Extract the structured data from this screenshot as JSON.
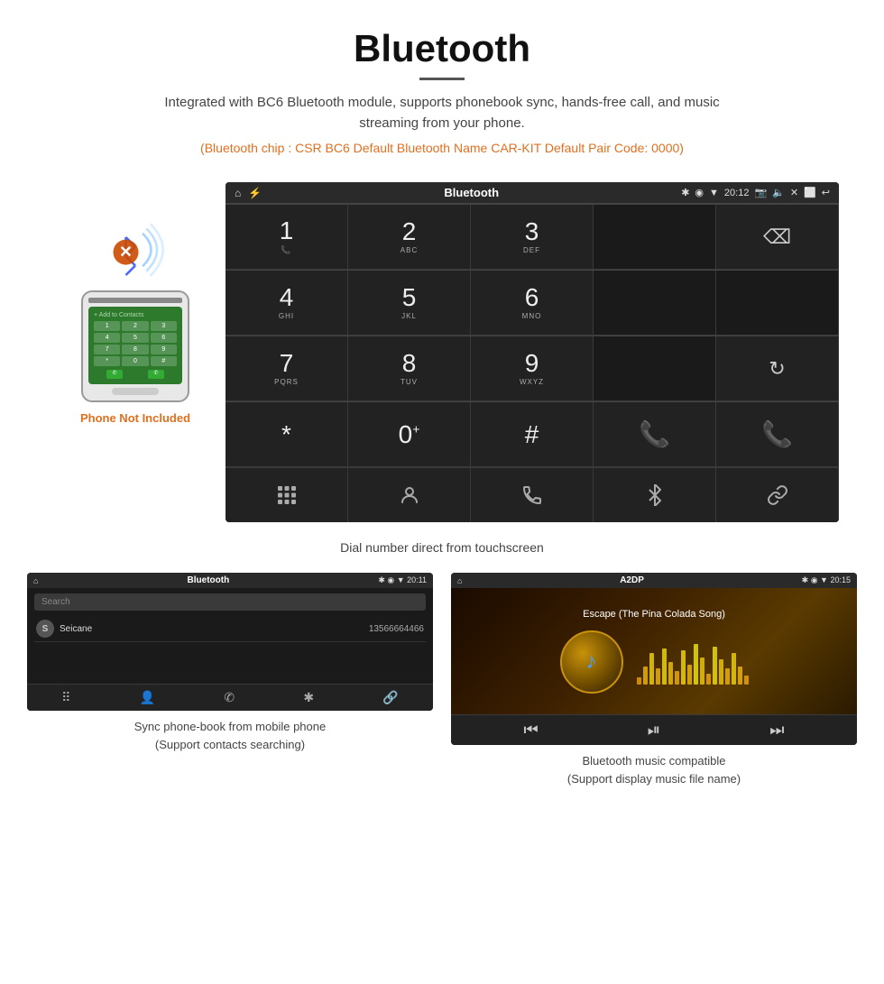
{
  "header": {
    "title": "Bluetooth",
    "subtitle": "Integrated with BC6 Bluetooth module, supports phonebook sync, hands-free call, and music streaming from your phone.",
    "specs": "(Bluetooth chip : CSR BC6    Default Bluetooth Name CAR-KIT    Default Pair Code: 0000)",
    "divider": true
  },
  "phone_note": "Phone Not Included",
  "dialpad_screen": {
    "status_left": "🏠",
    "status_center": "Bluetooth",
    "status_time": "20:12",
    "caption": "Dial number direct from touchscreen",
    "keys": [
      {
        "num": "1",
        "sub": ""
      },
      {
        "num": "2",
        "sub": "ABC"
      },
      {
        "num": "3",
        "sub": "DEF"
      },
      {
        "num": "",
        "sub": ""
      },
      {
        "num": "⌫",
        "sub": ""
      }
    ],
    "keys2": [
      {
        "num": "4",
        "sub": "GHI"
      },
      {
        "num": "5",
        "sub": "JKL"
      },
      {
        "num": "6",
        "sub": "MNO"
      },
      {
        "num": "",
        "sub": ""
      },
      {
        "num": "",
        "sub": ""
      }
    ],
    "keys3": [
      {
        "num": "7",
        "sub": "PQRS"
      },
      {
        "num": "8",
        "sub": "TUV"
      },
      {
        "num": "9",
        "sub": "WXYZ"
      },
      {
        "num": "",
        "sub": ""
      },
      {
        "num": "↻",
        "sub": ""
      }
    ],
    "keys4": [
      {
        "num": "*",
        "sub": ""
      },
      {
        "num": "0",
        "sub": "+"
      },
      {
        "num": "#",
        "sub": ""
      },
      {
        "num": "✆",
        "sub": "",
        "color": "green"
      },
      {
        "num": "✆",
        "sub": "",
        "color": "red"
      }
    ],
    "bottom_icons": [
      "⠿",
      "👤",
      "✆",
      "✱",
      "🔗"
    ]
  },
  "phonebook_screen": {
    "status_center": "Bluetooth",
    "status_time": "20:11",
    "search_placeholder": "Search",
    "contact_initial": "S",
    "contact_name": "Seicane",
    "contact_phone": "13566664466",
    "bottom_icons": [
      "⠿",
      "👤",
      "✆",
      "✱",
      "🔗"
    ],
    "caption_line1": "Sync phone-book from mobile phone",
    "caption_line2": "(Support contacts searching)"
  },
  "music_screen": {
    "status_center": "A2DP",
    "status_time": "20:15",
    "song_title": "Escape (The Pina Colada Song)",
    "eq_bars": [
      8,
      20,
      35,
      18,
      40,
      25,
      15,
      38,
      22,
      45,
      30,
      12,
      42,
      28,
      18,
      35,
      20,
      10
    ],
    "caption_line1": "Bluetooth music compatible",
    "caption_line2": "(Support display music file name)"
  }
}
